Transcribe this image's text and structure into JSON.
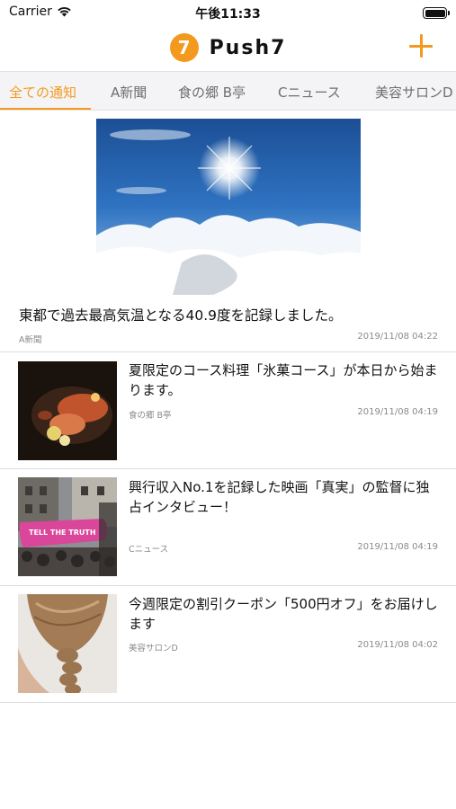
{
  "status_bar": {
    "carrier": "Carrier",
    "time": "午後11:33"
  },
  "header": {
    "logo_glyph": "7",
    "app_name": "Push7",
    "accent_color": "#f39a1e"
  },
  "tabs": [
    {
      "label": "全ての通知",
      "active": true
    },
    {
      "label": "A新聞",
      "active": false
    },
    {
      "label": "食の郷 B亭",
      "active": false
    },
    {
      "label": "Cニュース",
      "active": false
    },
    {
      "label": "美容サロンD",
      "active": false
    }
  ],
  "feed": {
    "featured": {
      "title": "東都で過去最高気温となる40.9度を記録しました。",
      "source": "A新聞",
      "date": "2019/11/08 04:22"
    },
    "items": [
      {
        "title": "夏限定のコース料理「氷菓コース」が本日から始まります。",
        "source": "食の郷 B亭",
        "date": "2019/11/08 04:19"
      },
      {
        "title": "興行収入No.1を記録した映画「真実」の監督に独占インタビュー！",
        "source": "Cニュース",
        "date": "2019/11/08 04:19"
      },
      {
        "title": "今週限定の割引クーポン「500円オフ」をお届けします",
        "source": "美容サロンD",
        "date": "2019/11/08 04:02"
      }
    ]
  }
}
